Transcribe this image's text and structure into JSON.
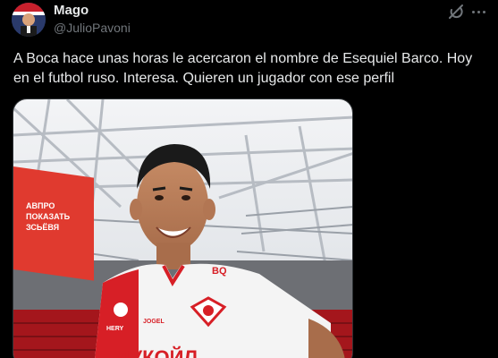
{
  "author": {
    "display_name": "Mago",
    "handle": "@JulioPavoni"
  },
  "tweet": {
    "text": "A Boca hace unas horas le acercaron el nombre de Esequiel Barco. Hoy en el futbol ruso. Interesa. Quieren un jugador con ese perfil"
  },
  "media": {
    "banner_text": [
      "АВПРО",
      "ПОКАЗАТЬ",
      "ЗСЬЁВЯ"
    ],
    "shirt_number_patch": "ВQ",
    "shirt_sponsor": "ЛУКОЙЛ",
    "kit_brand": "JOGEL"
  },
  "icons": {
    "grok": "grok-icon",
    "more": "more-icon"
  },
  "colors": {
    "background": "#000000",
    "text_primary": "#e7e9ea",
    "text_secondary": "#71767b",
    "spartak_red": "#d71f26"
  }
}
